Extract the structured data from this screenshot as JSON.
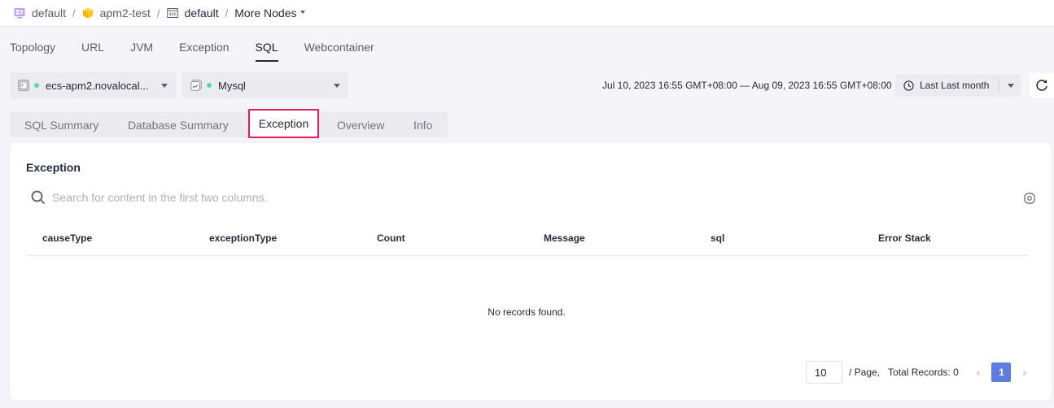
{
  "breadcrumb": [
    {
      "label": "default",
      "icon": "workspace-icon"
    },
    {
      "label": "apm2-test",
      "icon": "cube-icon"
    },
    {
      "label": "default",
      "icon": "code-window-icon"
    },
    {
      "label": "More Nodes",
      "icon": "chevron-down-icon"
    }
  ],
  "breadcrumb_separator": "/",
  "main_tabs": [
    "Topology",
    "URL",
    "JVM",
    "Exception",
    "SQL",
    "Webcontainer"
  ],
  "main_tab_active": "SQL",
  "selectors": {
    "host": {
      "value": "ecs-apm2.novalocal...",
      "status_color": "#5bd8a6"
    },
    "database": {
      "value": "Mysql",
      "status_color": "#5bd8a6"
    }
  },
  "time": {
    "range": "Jul 10, 2023 16:55 GMT+08:00 — Aug 09, 2023 16:55 GMT+08:00",
    "preset": "Last Last month"
  },
  "sub_tabs": [
    "SQL Summary",
    "Database Summary",
    "Exception",
    "Overview",
    "Info"
  ],
  "sub_tab_active": "Exception",
  "card": {
    "title": "Exception",
    "search_placeholder": "Search for content in the first two columns.",
    "columns": [
      "causeType",
      "exceptionType",
      "Count",
      "Message",
      "sql",
      "Error Stack"
    ],
    "rows": [],
    "empty_text": "No records found."
  },
  "pagination": {
    "page_size": "10",
    "per_page_label": "/ Page,",
    "total_label": "Total Records: 0",
    "current_page": "1"
  },
  "colors": {
    "accent": "#5e7ce0",
    "highlight_border": "#e6195a",
    "status_ok": "#5bd8a6"
  }
}
